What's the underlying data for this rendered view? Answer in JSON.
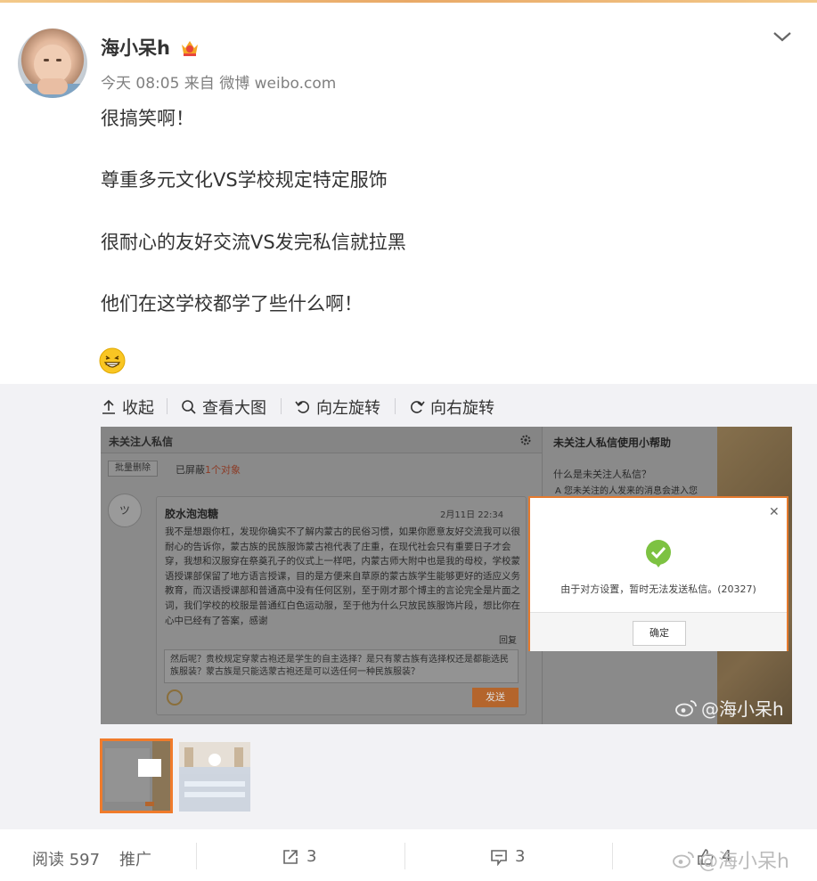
{
  "post": {
    "username": "海小呆h",
    "meta": "今天 08:05 来自 微博 weibo.com",
    "lines": [
      "很搞笑啊！",
      "尊重多元文化VS学校规定特定服饰",
      "很耐心的友好交流VS发完私信就拉黑",
      "他们在这学校都学了些什么啊！"
    ],
    "emoji": "grin-emoji"
  },
  "toolbar": {
    "collapse": "收起",
    "view_large": "查看大图",
    "rotate_left": "向左旋转",
    "rotate_right": "向右旋转"
  },
  "screenshot": {
    "title": "未关注人私信",
    "batch_delete": "批量删除",
    "blocked_prefix": "已屏蔽",
    "blocked_count": "1个对象",
    "avatar_text": "ツ",
    "sender": "胶水泡泡糖",
    "date": "2月11日 22:34",
    "body": "我不是想跟你杠，发现你确实不了解内蒙古的民俗习惯，如果你愿意友好交流我可以很耐心的告诉你，蒙古族的民族服饰蒙古袍代表了庄重，在现代社会只有重要日子才会穿，我想和汉服穿在祭奠孔子的仪式上一样吧，内蒙古师大附中也是我的母校，学校蒙语授课部保留了地方语言授课，目的是方便来自草原的蒙古族学生能够更好的适应义务教育，而汉语授课部和普通高中没有任何区别，至于刚才那个博主的言论完全是片面之词，我们学校的校服是普通红白色运动服，至于他为什么只放民族服饰片段，想比你在心中已经有了答案，感谢",
    "reply_label": "回复",
    "input_text": "然后呢？贵校规定穿蒙古袍还是学生的自主选择？是只有蒙古族有选择权还是都能选民族服装？蒙古族是只能选蒙古袍还是可以选任何一种民族服装？",
    "send": "发送",
    "help_title": "未关注人私信使用小帮助",
    "help_q": "什么是未关注人私信？",
    "help_a": "A 您未关注的人发来的消息会进入您",
    "dialog_msg": "由于对方设置，暂时无法发送私信。(20327)",
    "dialog_ok": "确定",
    "watermark": "@海小呆h"
  },
  "footer": {
    "reads": "阅读 597",
    "promote": "推广",
    "reposts": "3",
    "comments": "3",
    "likes": "4",
    "watermark": "@海小呆h"
  },
  "colors": {
    "accent": "#f07b2b",
    "check": "#7dc242"
  }
}
